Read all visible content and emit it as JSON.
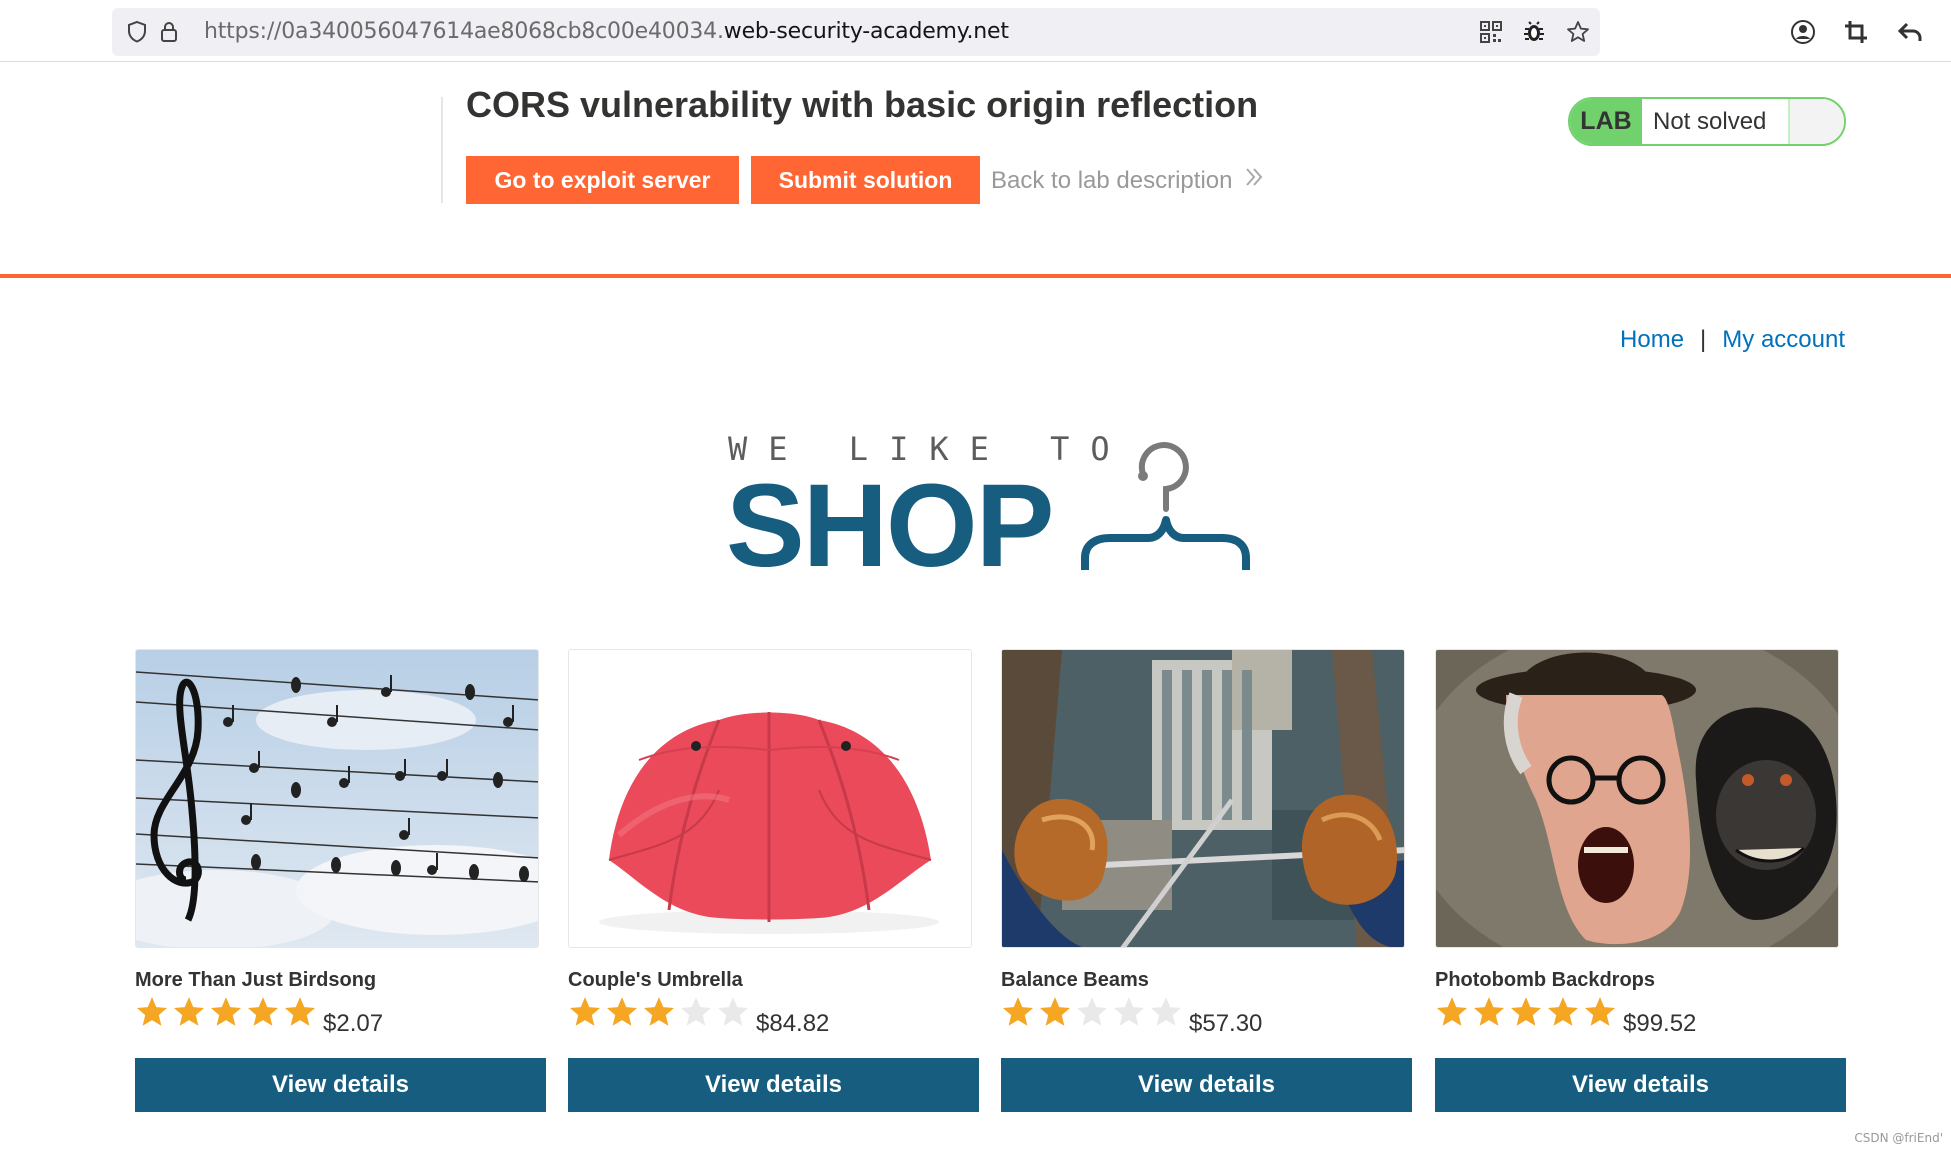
{
  "browser": {
    "url_prefix": "https://0a340056047614ae8068cb8c00e40034.",
    "url_domain": "web-security-academy.net"
  },
  "lab": {
    "title": "CORS vulnerability with basic origin reflection",
    "exploit_button": "Go to exploit server",
    "submit_button": "Submit solution",
    "back_link": "Back to lab description",
    "badge": "LAB",
    "status": "Not solved"
  },
  "nav": {
    "home": "Home",
    "separator": "|",
    "account": "My account"
  },
  "logo": {
    "tagline": "WE LIKE TO",
    "word": "SHOP"
  },
  "colors": {
    "accent_orange": "#ff6633",
    "lab_green": "#70d16d",
    "brand_blue": "#165d80",
    "link_blue": "#0071bc",
    "star_filled": "#f5a623",
    "star_empty": "#e9e9e9"
  },
  "products": [
    {
      "name": "More Than Just Birdsong",
      "rating": 5,
      "rating_max": 5,
      "price": "$2.07",
      "button": "View details",
      "image": "birds-on-wires-music-staff"
    },
    {
      "name": "Couple's Umbrella",
      "rating": 3,
      "rating_max": 5,
      "price": "$84.82",
      "button": "View details",
      "image": "red-double-umbrella"
    },
    {
      "name": "Balance Beams",
      "rating": 2,
      "rating_max": 5,
      "price": "$57.30",
      "button": "View details",
      "image": "feet-over-city"
    },
    {
      "name": "Photobomb Backdrops",
      "rating": 5,
      "rating_max": 5,
      "price": "$99.52",
      "button": "View details",
      "image": "man-and-monkey"
    }
  ],
  "watermark": "CSDN @friEnd'"
}
